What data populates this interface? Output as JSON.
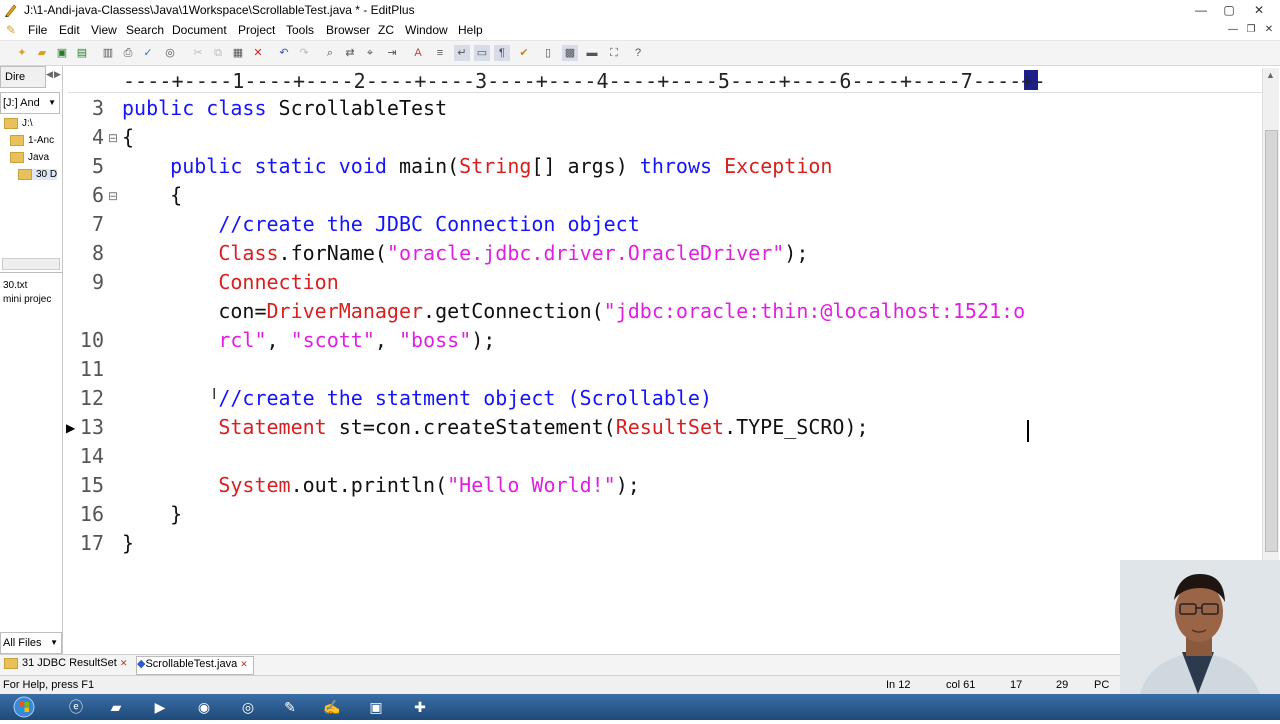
{
  "window": {
    "title": "J:\\1-Andi-java-Classess\\Java\\1Workspace\\ScrollableTest.java * - EditPlus",
    "minimize": "—",
    "maximize": "▢",
    "close": "✕"
  },
  "menu": {
    "items": [
      "File",
      "Edit",
      "View",
      "Search",
      "Document",
      "Project",
      "Tools",
      "Browser",
      "ZC",
      "Window",
      "Help"
    ]
  },
  "left_panel": {
    "tab1": "Dire",
    "drive": "[J:] And",
    "folders": [
      "J:\\",
      "1-Anc",
      "Java",
      "30 D"
    ],
    "files": [
      "30.txt",
      "mini projec"
    ],
    "filter": "All Files"
  },
  "ruler": {
    "text": "----+----1----+----2----+----3----+----4----+----5----+----6----+----7----+-"
  },
  "editor": {
    "line_numbers": [
      "3",
      "4",
      "5",
      "6",
      "7",
      "8",
      "9",
      "",
      "10",
      "11",
      "12",
      "13",
      "14",
      "15",
      "16",
      "17"
    ],
    "lines": [
      {
        "segments": [
          {
            "t": "public class ",
            "c": "kw"
          },
          {
            "t": "ScrollableTest",
            "c": "def"
          }
        ]
      },
      {
        "segments": [
          {
            "t": "{",
            "c": "def"
          }
        ]
      },
      {
        "segments": [
          {
            "t": "    public static void ",
            "c": "kw"
          },
          {
            "t": "main(",
            "c": "def"
          },
          {
            "t": "String",
            "c": "cls"
          },
          {
            "t": "[] args) ",
            "c": "def"
          },
          {
            "t": "throws ",
            "c": "kw"
          },
          {
            "t": "Exception",
            "c": "cls"
          }
        ]
      },
      {
        "segments": [
          {
            "t": "    {",
            "c": "def"
          }
        ]
      },
      {
        "segments": [
          {
            "t": "        //create the JDBC Connection object",
            "c": "cm"
          }
        ]
      },
      {
        "segments": [
          {
            "t": "        Class",
            "c": "cls"
          },
          {
            "t": ".forName(",
            "c": "def"
          },
          {
            "t": "\"oracle.jdbc.driver.OracleDriver\"",
            "c": "str"
          },
          {
            "t": ");",
            "c": "def"
          }
        ]
      },
      {
        "segments": [
          {
            "t": "        Connection",
            "c": "cls"
          }
        ]
      },
      {
        "segments": [
          {
            "t": "        con=",
            "c": "def"
          },
          {
            "t": "DriverManager",
            "c": "cls"
          },
          {
            "t": ".getConnection(",
            "c": "def"
          },
          {
            "t": "\"jdbc:oracle:thin:@localhost:1521:o",
            "c": "str"
          }
        ]
      },
      {
        "segments": [
          {
            "t": "        rcl\"",
            "c": "str"
          },
          {
            "t": ", ",
            "c": "def"
          },
          {
            "t": "\"scott\"",
            "c": "str"
          },
          {
            "t": ", ",
            "c": "def"
          },
          {
            "t": "\"boss\"",
            "c": "str"
          },
          {
            "t": ");",
            "c": "def"
          }
        ]
      },
      {
        "segments": []
      },
      {
        "segments": [
          {
            "t": "        //create the statment object (Scrollable)",
            "c": "cm"
          }
        ]
      },
      {
        "segments": [
          {
            "t": "        Statement",
            "c": "cls"
          },
          {
            "t": " st=con.createStatement(",
            "c": "def"
          },
          {
            "t": "ResultSet",
            "c": "cls"
          },
          {
            "t": ".TYPE_SCRO);",
            "c": "def"
          }
        ]
      },
      {
        "segments": []
      },
      {
        "segments": [
          {
            "t": "        System",
            "c": "cls"
          },
          {
            "t": ".out.println(",
            "c": "def"
          },
          {
            "t": "\"Hello World!\"",
            "c": "str"
          },
          {
            "t": ");",
            "c": "def"
          }
        ]
      },
      {
        "segments": [
          {
            "t": "    }",
            "c": "def"
          }
        ]
      },
      {
        "segments": [
          {
            "t": "}",
            "c": "def"
          }
        ]
      }
    ]
  },
  "tabs": {
    "items": [
      "31 JDBC ResultSet",
      "ScrollableTest.java"
    ]
  },
  "status": {
    "help": "For Help, press F1",
    "line": "In 12",
    "col": "col 61",
    "v1": "17",
    "v2": "29",
    "mode": "PC"
  },
  "icons": {
    "app": "editplus-pen-icon",
    "start": "windows-start-icon"
  }
}
